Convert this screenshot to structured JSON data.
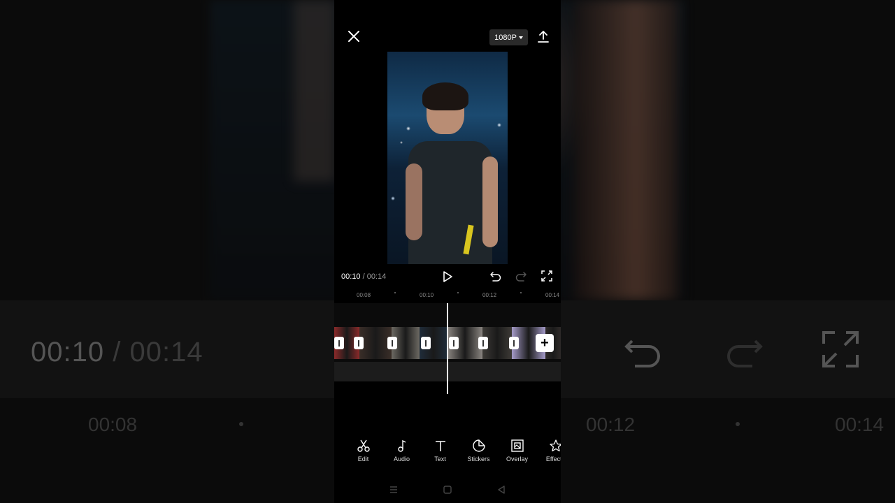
{
  "header": {
    "resolution_label": "1080P",
    "close_icon": "close-icon",
    "export_icon": "export-icon"
  },
  "player": {
    "current_time": "00:10",
    "separator": "/",
    "total_time": "00:14"
  },
  "ruler": {
    "ticks": [
      "00:08",
      "00:10",
      "00:12",
      "00:14"
    ]
  },
  "timeline": {
    "add_label": "+",
    "clip_colors": [
      "#8b2a2a",
      "#3a2e28",
      "#6d6a63",
      "#1f2c3a",
      "#8a8580",
      "#3d3a36",
      "#a59bc9",
      "#2e2a28"
    ]
  },
  "toolbar": {
    "items": [
      {
        "label": "Edit",
        "icon": "scissors-icon"
      },
      {
        "label": "Audio",
        "icon": "music-note-icon"
      },
      {
        "label": "Text",
        "icon": "text-icon"
      },
      {
        "label": "Stickers",
        "icon": "sticker-icon"
      },
      {
        "label": "Overlay",
        "icon": "overlay-icon"
      },
      {
        "label": "Effects",
        "icon": "effects-star-icon"
      }
    ]
  },
  "background": {
    "current_time": "00:10",
    "separator": "/",
    "total_time": "00:14",
    "ticks": [
      "00:08",
      "00:12",
      "00:14"
    ]
  }
}
